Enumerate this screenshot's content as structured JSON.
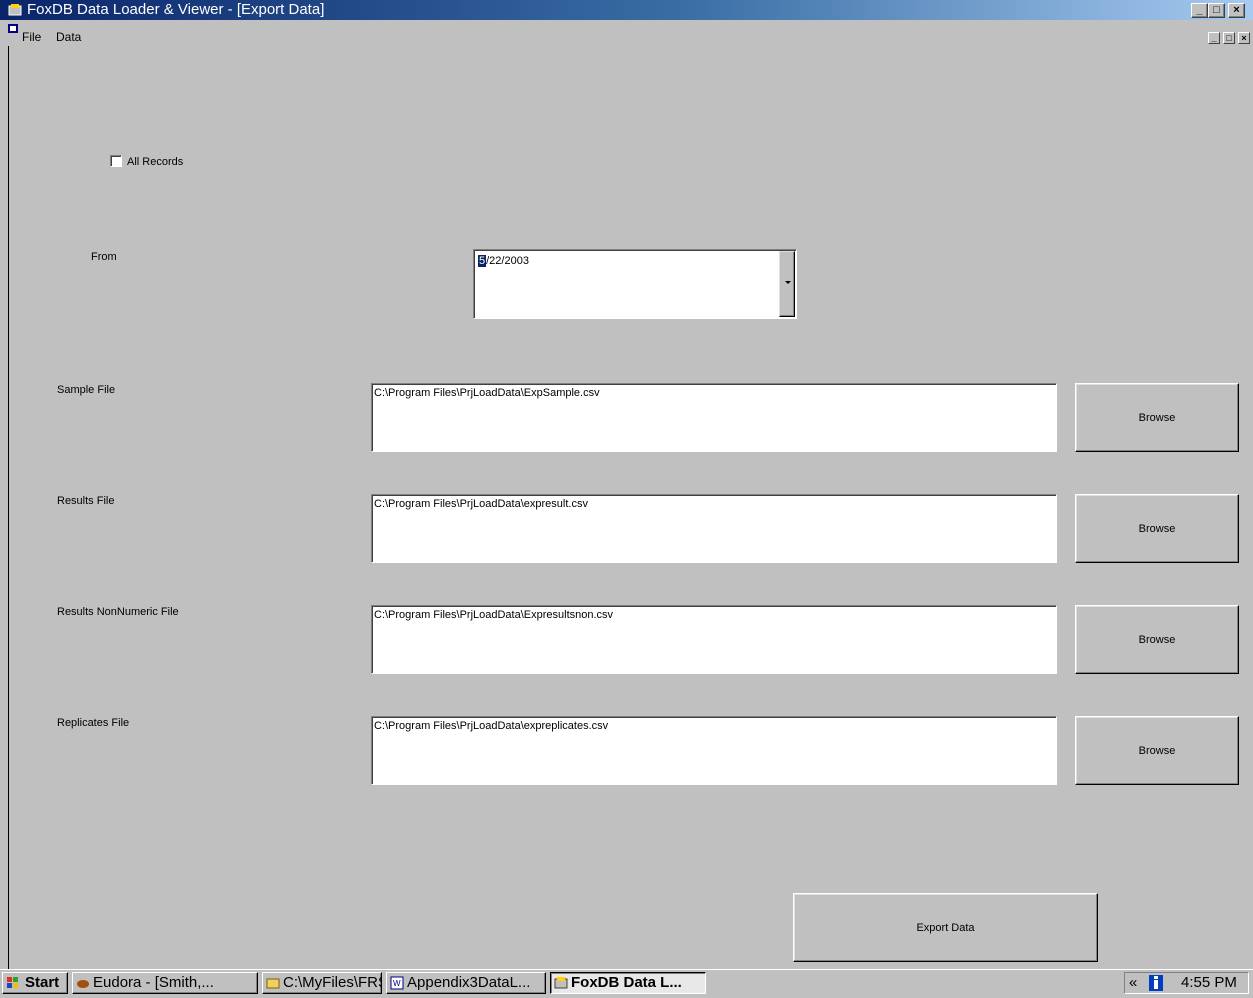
{
  "window": {
    "title": "FoxDB Data Loader & Viewer - [Export Data]"
  },
  "menu": {
    "items": [
      "File",
      "Data"
    ]
  },
  "form": {
    "all_records_label": "All Records",
    "all_records_checked": false,
    "from_label": "From",
    "from_date_selected": "5",
    "from_date_rest": "/22/2003",
    "sample_label": "Sample File",
    "sample_value": "C:\\Program Files\\PrjLoadData\\ExpSample.csv",
    "results_label": "Results File",
    "results_value": "C:\\Program Files\\PrjLoadData\\expresult.csv",
    "nonnumeric_label": "Results NonNumeric File",
    "nonnumeric_value": "C:\\Program Files\\PrjLoadData\\Expresultsnon.csv",
    "replicates_label": "Replicates File",
    "replicates_value": "C:\\Program Files\\PrjLoadData\\expreplicates.csv",
    "browse_label": "Browse",
    "export_label": "Export Data"
  },
  "taskbar": {
    "start_label": "Start",
    "tasks": [
      "Eudora - [Smith,...",
      "C:\\MyFiles\\FRS...",
      "Appendix3DataL...",
      "FoxDB Data L..."
    ],
    "tray_chevron": "«",
    "clock": "4:55 PM"
  },
  "colors": {
    "titlebar": "#0a246a",
    "face": "#c0c0c0",
    "selection": "#0a246a"
  }
}
